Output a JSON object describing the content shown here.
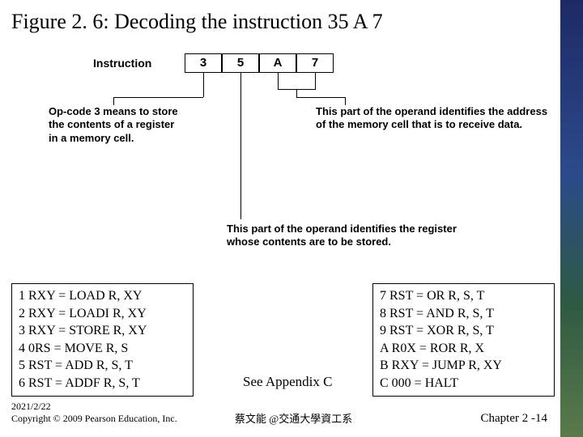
{
  "title": "Figure 2. 6:  Decoding the instruction 35 A 7",
  "diagram": {
    "label": "Instruction",
    "nibbles": [
      "3",
      "5",
      "A",
      "7"
    ],
    "explain_opcode": "Op-code 3 means to store the contents of a register in a memory cell.",
    "explain_address": "This part of the operand identifies the address of the memory cell that is to receive data.",
    "explain_register": "This part of the operand identifies the register whose contents are to be stored."
  },
  "opcodes_left": [
    "1 RXY  = LOAD R, XY",
    "2 RXY  = LOADI R, XY",
    "3 RXY = STORE R, XY",
    "4 0RS  =  MOVE R, S",
    "5 RST = ADD R, S, T",
    "6 RST = ADDF R, S, T"
  ],
  "opcodes_right": [
    "7 RST  = OR R, S, T",
    "8 RST  = AND R, S, T",
    "9 RST = XOR R, S, T",
    "A R0X = ROR R, X",
    "B RXY = JUMP R, XY",
    "C 000   = HALT"
  ],
  "appendix": "See Appendix C",
  "footer": {
    "date": "2021/2/22",
    "copyright": "Copyright © 2009 Pearson Education, Inc.",
    "author": "蔡文能 @交通大學資工系",
    "pagenum": "Chapter 2 -14"
  }
}
